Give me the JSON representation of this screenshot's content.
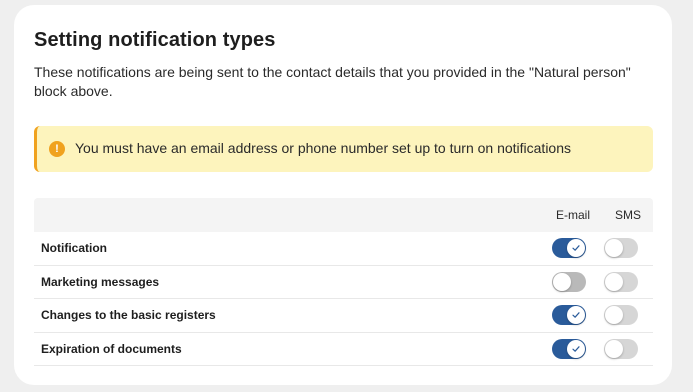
{
  "section": {
    "title": "Setting notification types",
    "description": "These notifications are being sent to the contact details that you provided in the \"Natural person\" block above."
  },
  "alert": {
    "icon": "info-icon",
    "icon_glyph": "!",
    "text": "You must have an email address or phone number set up to turn on notifications",
    "accent_color": "#f0a21f",
    "background_color": "#fdf4bd"
  },
  "table": {
    "columns": {
      "email": "E-mail",
      "sms": "SMS"
    },
    "rows": [
      {
        "label": "Notification",
        "email": true,
        "sms": false
      },
      {
        "label": "Marketing messages",
        "email": false,
        "sms": false
      },
      {
        "label": "Changes to the basic registers",
        "email": true,
        "sms": false
      },
      {
        "label": "Expiration of documents",
        "email": true,
        "sms": false
      }
    ]
  },
  "colors": {
    "toggle_on": "#2a5b9a",
    "toggle_off": "#d6d6d6"
  }
}
